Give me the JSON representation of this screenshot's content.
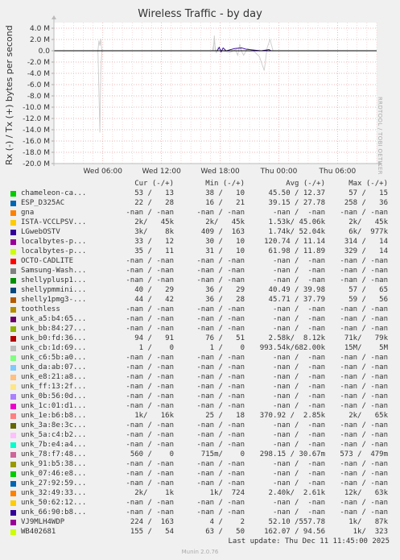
{
  "chart_data": {
    "type": "line",
    "title": "Wireless Traffic - by day",
    "ylabel": "Rx (-) / Tx (+) bytes per second",
    "side_label": "RRDTOOL / TOBI OETIKER",
    "ylim": [
      -20000000,
      5000000
    ],
    "y_ticks": [
      "4.0 M",
      "2.0 M",
      "0.0",
      "-2.0 M",
      "-4.0 M",
      "-6.0 M",
      "-8.0 M",
      "-10.0 M",
      "-12.0 M",
      "-14.0 M",
      "-16.0 M",
      "-18.0 M",
      "-20.0 M"
    ],
    "y_tick_values": [
      4,
      2,
      0,
      -2,
      -4,
      -6,
      -8,
      -10,
      -12,
      -14,
      -16,
      -18,
      -20
    ],
    "x_ticks": [
      "Wed 06:00",
      "Wed 12:00",
      "Wed 18:00",
      "Thu 00:00",
      "Thu 06:00"
    ],
    "x_tick_hours": [
      6,
      12,
      18,
      24,
      30
    ],
    "x_range_hours": [
      1,
      34
    ],
    "grid": true,
    "series": [
      {
        "name": "unk_1e:b6:b8...",
        "color": "#cccccc",
        "points": [
          [
            5.5,
            0
          ],
          [
            5.7,
            -14.5
          ],
          [
            5.8,
            -3.5
          ],
          [
            5.9,
            0
          ],
          [
            6.1,
            0
          ]
        ]
      },
      {
        "name": "unk_1e:b6:b8...",
        "color": "#cccccc",
        "points": [
          [
            5.5,
            0
          ],
          [
            5.6,
            1.8
          ],
          [
            5.7,
            0.9
          ],
          [
            5.8,
            2.1
          ],
          [
            5.9,
            0
          ]
        ]
      },
      {
        "name": "unk_1e:b6:b8...",
        "color": "#cccccc",
        "points": [
          [
            17.2,
            0
          ],
          [
            17.4,
            1.6
          ],
          [
            17.6,
            -0.4
          ],
          [
            17.8,
            0.6
          ],
          [
            18.2,
            0
          ],
          [
            19.0,
            -0.3
          ],
          [
            20.0,
            0.6
          ],
          [
            20.4,
            -0.8
          ],
          [
            20.8,
            0.4
          ],
          [
            21.4,
            0
          ],
          [
            22.0,
            -1.0
          ],
          [
            22.5,
            -3.5
          ],
          [
            22.8,
            0.5
          ],
          [
            23.1,
            2.0
          ],
          [
            23.4,
            0
          ],
          [
            24.0,
            0
          ]
        ]
      },
      {
        "name": "unk_1e:b6:b8...",
        "color": "#cccccc",
        "points": [
          [
            17.3,
            0
          ],
          [
            17.4,
            2.7
          ],
          [
            17.5,
            0
          ],
          [
            19.6,
            0
          ],
          [
            19.8,
            -0.8
          ],
          [
            20.0,
            1.2
          ],
          [
            20.2,
            0
          ]
        ]
      },
      {
        "name": "VJ9MLH4WDP",
        "color": "#330099",
        "points": [
          [
            17.7,
            0
          ],
          [
            17.9,
            0.6
          ],
          [
            18.1,
            -0.2
          ],
          [
            18.3,
            0.5
          ],
          [
            18.6,
            0
          ],
          [
            19.5,
            0.4
          ],
          [
            20.2,
            0.5
          ],
          [
            20.6,
            0.3
          ],
          [
            21.0,
            0.2
          ],
          [
            21.6,
            0.1
          ],
          [
            22.2,
            0
          ],
          [
            23.0,
            0.2
          ],
          [
            23.2,
            0
          ]
        ]
      }
    ]
  },
  "legend": {
    "headers": [
      "Cur (-/+)",
      "Min (-/+)",
      "Avg (-/+)",
      "Max (-/+)"
    ],
    "rows": [
      {
        "name": "chameleon-ca...",
        "color": "#00cc00",
        "cur": "53 /   13",
        "min": "38 /   10",
        "avg": "45.50 / 12.37",
        "max": "57 /   15"
      },
      {
        "name": "ESP_D325AC",
        "color": "#0066b3",
        "cur": "22 /   28",
        "min": "16 /   21",
        "avg": "39.15 / 27.78",
        "max": "258 /   36"
      },
      {
        "name": "gna",
        "color": "#ff8000",
        "cur": "-nan / -nan",
        "min": "-nan / -nan",
        "avg": "-nan /  -nan",
        "max": "-nan / -nan"
      },
      {
        "name": "ISTA-VCCLPSV...",
        "color": "#ffcc00",
        "cur": "2k/   45k",
        "min": "2k/   45k",
        "avg": "1.53k/ 45.06k",
        "max": "2k/   45k"
      },
      {
        "name": "LGwebOSTV",
        "color": "#330099",
        "cur": "3k/    8k",
        "min": "409 /  163",
        "avg": "1.74k/ 52.04k",
        "max": "6k/  977k"
      },
      {
        "name": "localbytes-p...",
        "color": "#990099",
        "cur": "33 /   12",
        "min": "30 /   10",
        "avg": "120.74 / 11.14",
        "max": "314 /   14"
      },
      {
        "name": "localbytes-p...",
        "color": "#ccff00",
        "cur": "35 /   11",
        "min": "31 /   10",
        "avg": "61.98 / 11.89",
        "max": "329 /   14"
      },
      {
        "name": "OCTO-CADLITE",
        "color": "#ff0000",
        "cur": "-nan / -nan",
        "min": "-nan / -nan",
        "avg": "-nan /  -nan",
        "max": "-nan / -nan"
      },
      {
        "name": "Samsung-Wash...",
        "color": "#808080",
        "cur": "-nan / -nan",
        "min": "-nan / -nan",
        "avg": "-nan /  -nan",
        "max": "-nan / -nan"
      },
      {
        "name": "shellyplusp1...",
        "color": "#008f00",
        "cur": "-nan / -nan",
        "min": "-nan / -nan",
        "avg": "-nan /  -nan",
        "max": "-nan / -nan"
      },
      {
        "name": "shellypmmini...",
        "color": "#00487d",
        "cur": "40 /   29",
        "min": "36 /   29",
        "avg": "40.49 / 39.98",
        "max": "57 /   65"
      },
      {
        "name": "shelly1pmg3-...",
        "color": "#b35a00",
        "cur": "44 /   42",
        "min": "36 /   28",
        "avg": "45.71 / 37.79",
        "max": "59 /   56"
      },
      {
        "name": "toothless",
        "color": "#b38f00",
        "cur": "-nan / -nan",
        "min": "-nan / -nan",
        "avg": "-nan /  -nan",
        "max": "-nan / -nan"
      },
      {
        "name": "unk_a5:b4:65...",
        "color": "#6b006b",
        "cur": "-nan / -nan",
        "min": "-nan / -nan",
        "avg": "-nan /  -nan",
        "max": "-nan / -nan"
      },
      {
        "name": "unk_bb:84:27...",
        "color": "#8fb300",
        "cur": "-nan / -nan",
        "min": "-nan / -nan",
        "avg": "-nan /  -nan",
        "max": "-nan / -nan"
      },
      {
        "name": "unk_b0:fd:36...",
        "color": "#b30000",
        "cur": "94 /   91",
        "min": "76 /   51",
        "avg": "2.58k/  8.12k",
        "max": "71k/   79k"
      },
      {
        "name": "unk_cb:1d:69...",
        "color": "#bebebe",
        "cur": "1 /    0",
        "min": "1 /    0",
        "avg": "993.54k/682.00k",
        "max": "15M/    5M"
      },
      {
        "name": "unk_c6:5b:a0...",
        "color": "#80ff80",
        "cur": "-nan / -nan",
        "min": "-nan / -nan",
        "avg": "-nan /  -nan",
        "max": "-nan / -nan"
      },
      {
        "name": "unk_da:ab:07...",
        "color": "#80c9ff",
        "cur": "-nan / -nan",
        "min": "-nan / -nan",
        "avg": "-nan /  -nan",
        "max": "-nan / -nan"
      },
      {
        "name": "unk_e8:21:a8...",
        "color": "#ffc080",
        "cur": "-nan / -nan",
        "min": "-nan / -nan",
        "avg": "-nan /  -nan",
        "max": "-nan / -nan"
      },
      {
        "name": "unk_ff:13:2f...",
        "color": "#ffe680",
        "cur": "-nan / -nan",
        "min": "-nan / -nan",
        "avg": "-nan /  -nan",
        "max": "-nan / -nan"
      },
      {
        "name": "unk_0b:56:0d...",
        "color": "#aa80ff",
        "cur": "-nan / -nan",
        "min": "-nan / -nan",
        "avg": "-nan /  -nan",
        "max": "-nan / -nan"
      },
      {
        "name": "unk_1c:01:d1...",
        "color": "#ee00cc",
        "cur": "-nan / -nan",
        "min": "-nan / -nan",
        "avg": "-nan /  -nan",
        "max": "-nan / -nan"
      },
      {
        "name": "unk_1e:b6:b8...",
        "color": "#ff8080",
        "cur": "1k/   16k",
        "min": "25 /   18",
        "avg": "370.92 /  2.85k",
        "max": "2k/   65k"
      },
      {
        "name": "unk_3a:8e:3c...",
        "color": "#666600",
        "cur": "-nan / -nan",
        "min": "-nan / -nan",
        "avg": "-nan /  -nan",
        "max": "-nan / -nan"
      },
      {
        "name": "unk_5a:c4:b2...",
        "color": "#ffbfff",
        "cur": "-nan / -nan",
        "min": "-nan / -nan",
        "avg": "-nan /  -nan",
        "max": "-nan / -nan"
      },
      {
        "name": "unk_7b:e4:a4...",
        "color": "#00ffcc",
        "cur": "-nan / -nan",
        "min": "-nan / -nan",
        "avg": "-nan /  -nan",
        "max": "-nan / -nan"
      },
      {
        "name": "unk_78:f7:48...",
        "color": "#cc6699",
        "cur": "560 /    0",
        "min": "715m/    0",
        "avg": "298.15 / 30.67m",
        "max": "573 /  479m"
      },
      {
        "name": "unk_91:b5:38...",
        "color": "#999900",
        "cur": "-nan / -nan",
        "min": "-nan / -nan",
        "avg": "-nan /  -nan",
        "max": "-nan / -nan"
      },
      {
        "name": "unk_07:46:e8...",
        "color": "#00cc00",
        "cur": "-nan / -nan",
        "min": "-nan / -nan",
        "avg": "-nan /  -nan",
        "max": "-nan / -nan"
      },
      {
        "name": "unk_27:92:59...",
        "color": "#0066b3",
        "cur": "-nan / -nan",
        "min": "-nan / -nan",
        "avg": "-nan /  -nan",
        "max": "-nan / -nan"
      },
      {
        "name": "unk_32:49:33...",
        "color": "#ff8000",
        "cur": "2k/    1k",
        "min": "1k/  724",
        "avg": "2.40k/  2.61k",
        "max": "12k/   63k"
      },
      {
        "name": "unk_50:62:12...",
        "color": "#ffcc00",
        "cur": "-nan / -nan",
        "min": "-nan / -nan",
        "avg": "-nan /  -nan",
        "max": "-nan / -nan"
      },
      {
        "name": "unk_66:90:b8...",
        "color": "#330099",
        "cur": "-nan / -nan",
        "min": "-nan / -nan",
        "avg": "-nan /  -nan",
        "max": "-nan / -nan"
      },
      {
        "name": "VJ9MLH4WDP",
        "color": "#990099",
        "cur": "224 /  163",
        "min": "4 /    2",
        "avg": "52.10 /557.78",
        "max": "1k/   87k"
      },
      {
        "name": "WB402681",
        "color": "#ccff00",
        "cur": "155 /   54",
        "min": "63 /   50",
        "avg": "162.07 / 94.56",
        "max": "1k/  323"
      }
    ]
  },
  "footer": {
    "last_update": "Last update: Thu Dec 11 11:45:00 2025",
    "version": "Munin 2.0.76"
  }
}
